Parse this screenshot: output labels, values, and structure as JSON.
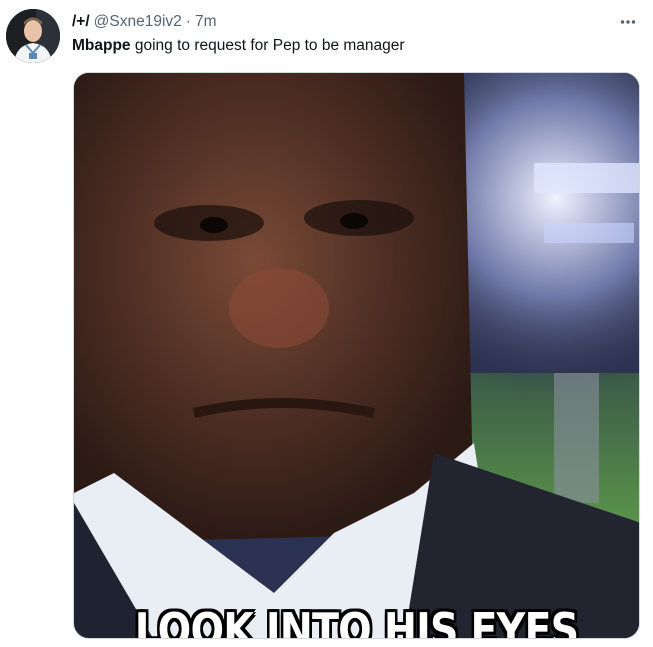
{
  "tweet": {
    "author": {
      "display_name": "/+/",
      "handle": "@Sxne19iv2",
      "avatar_icon": "user-avatar"
    },
    "separator": "·",
    "time": "7m",
    "more_icon": "more-horizontal-icon",
    "text": {
      "mention": "Mbappe",
      "body": " going to request for Pep to be manager"
    },
    "media": {
      "caption": "LOOK INTO HIS EYES"
    }
  }
}
